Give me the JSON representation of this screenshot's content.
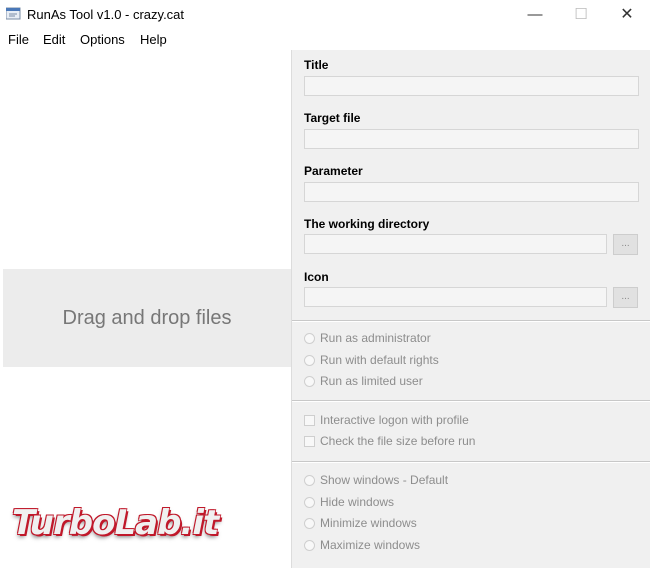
{
  "window": {
    "title": "RunAs Tool v1.0 - crazy.cat",
    "minimize_glyph": "—",
    "maximize_glyph": "☐",
    "close_glyph": "✕"
  },
  "menu": {
    "items": [
      {
        "label": "File"
      },
      {
        "label": "Edit"
      },
      {
        "label": "Options"
      },
      {
        "label": "Help"
      }
    ]
  },
  "drop_zone": {
    "text": "Drag and drop files"
  },
  "form": {
    "title_label": "Title",
    "title_value": "",
    "target_label": "Target file",
    "target_value": "",
    "parameter_label": "Parameter",
    "parameter_value": "",
    "workdir_label": "The working directory",
    "workdir_value": "",
    "workdir_browse": "...",
    "icon_label": "Icon",
    "icon_value": "",
    "icon_browse": "..."
  },
  "run_options": [
    {
      "label": "Run as administrator"
    },
    {
      "label": "Run with default rights"
    },
    {
      "label": "Run as limited user"
    }
  ],
  "check_options": [
    {
      "label": "Interactive logon with profile"
    },
    {
      "label": "Check the file size before run"
    }
  ],
  "window_options": [
    {
      "label": "Show windows - Default"
    },
    {
      "label": "Hide windows"
    },
    {
      "label": "Minimize windows"
    },
    {
      "label": "Maximize windows"
    }
  ],
  "watermark": {
    "text": "TurboLab.it"
  },
  "colors": {
    "watermark_accent": "#c0182a",
    "drop_text": "#777777",
    "disabled_text": "#8d8d8d"
  }
}
